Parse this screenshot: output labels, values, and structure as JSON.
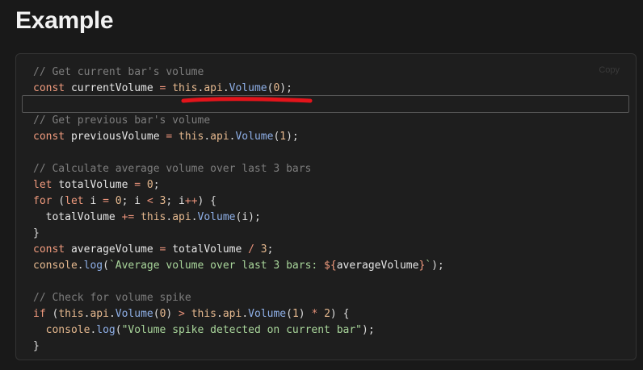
{
  "heading": "Example",
  "copy_label": "Copy",
  "annotation": {
    "underline_color": "#e3141b",
    "box_color": "#565656"
  },
  "code": {
    "lines": [
      [
        {
          "t": "comment",
          "v": "// Get current bar's volume"
        }
      ],
      [
        {
          "t": "keyword",
          "v": "const"
        },
        {
          "t": "punct",
          "v": " "
        },
        {
          "t": "ident",
          "v": "currentVolume"
        },
        {
          "t": "punct",
          "v": " "
        },
        {
          "t": "op",
          "v": "="
        },
        {
          "t": "punct",
          "v": " "
        },
        {
          "t": "property",
          "v": "this"
        },
        {
          "t": "punct",
          "v": "."
        },
        {
          "t": "property",
          "v": "api"
        },
        {
          "t": "punct",
          "v": "."
        },
        {
          "t": "func",
          "v": "Volume"
        },
        {
          "t": "punct",
          "v": "("
        },
        {
          "t": "number",
          "v": "0"
        },
        {
          "t": "punct",
          "v": ");"
        }
      ],
      [],
      [
        {
          "t": "comment",
          "v": "// Get previous bar's volume"
        }
      ],
      [
        {
          "t": "keyword",
          "v": "const"
        },
        {
          "t": "punct",
          "v": " "
        },
        {
          "t": "ident",
          "v": "previousVolume"
        },
        {
          "t": "punct",
          "v": " "
        },
        {
          "t": "op",
          "v": "="
        },
        {
          "t": "punct",
          "v": " "
        },
        {
          "t": "property",
          "v": "this"
        },
        {
          "t": "punct",
          "v": "."
        },
        {
          "t": "property",
          "v": "api"
        },
        {
          "t": "punct",
          "v": "."
        },
        {
          "t": "func",
          "v": "Volume"
        },
        {
          "t": "punct",
          "v": "("
        },
        {
          "t": "number",
          "v": "1"
        },
        {
          "t": "punct",
          "v": ");"
        }
      ],
      [],
      [
        {
          "t": "comment",
          "v": "// Calculate average volume over last 3 bars"
        }
      ],
      [
        {
          "t": "keyword",
          "v": "let"
        },
        {
          "t": "punct",
          "v": " "
        },
        {
          "t": "ident",
          "v": "totalVolume"
        },
        {
          "t": "punct",
          "v": " "
        },
        {
          "t": "op",
          "v": "="
        },
        {
          "t": "punct",
          "v": " "
        },
        {
          "t": "number",
          "v": "0"
        },
        {
          "t": "punct",
          "v": ";"
        }
      ],
      [
        {
          "t": "keyword",
          "v": "for"
        },
        {
          "t": "punct",
          "v": " ("
        },
        {
          "t": "keyword",
          "v": "let"
        },
        {
          "t": "punct",
          "v": " "
        },
        {
          "t": "ident",
          "v": "i"
        },
        {
          "t": "punct",
          "v": " "
        },
        {
          "t": "op",
          "v": "="
        },
        {
          "t": "punct",
          "v": " "
        },
        {
          "t": "number",
          "v": "0"
        },
        {
          "t": "punct",
          "v": "; "
        },
        {
          "t": "ident",
          "v": "i"
        },
        {
          "t": "punct",
          "v": " "
        },
        {
          "t": "op",
          "v": "<"
        },
        {
          "t": "punct",
          "v": " "
        },
        {
          "t": "number",
          "v": "3"
        },
        {
          "t": "punct",
          "v": "; "
        },
        {
          "t": "ident",
          "v": "i"
        },
        {
          "t": "op",
          "v": "++"
        },
        {
          "t": "punct",
          "v": ") {"
        }
      ],
      [
        {
          "t": "punct",
          "v": "  "
        },
        {
          "t": "ident",
          "v": "totalVolume"
        },
        {
          "t": "punct",
          "v": " "
        },
        {
          "t": "op",
          "v": "+="
        },
        {
          "t": "punct",
          "v": " "
        },
        {
          "t": "property",
          "v": "this"
        },
        {
          "t": "punct",
          "v": "."
        },
        {
          "t": "property",
          "v": "api"
        },
        {
          "t": "punct",
          "v": "."
        },
        {
          "t": "func",
          "v": "Volume"
        },
        {
          "t": "punct",
          "v": "("
        },
        {
          "t": "ident",
          "v": "i"
        },
        {
          "t": "punct",
          "v": ");"
        }
      ],
      [
        {
          "t": "punct",
          "v": "}"
        }
      ],
      [
        {
          "t": "keyword",
          "v": "const"
        },
        {
          "t": "punct",
          "v": " "
        },
        {
          "t": "ident",
          "v": "averageVolume"
        },
        {
          "t": "punct",
          "v": " "
        },
        {
          "t": "op",
          "v": "="
        },
        {
          "t": "punct",
          "v": " "
        },
        {
          "t": "ident",
          "v": "totalVolume"
        },
        {
          "t": "punct",
          "v": " "
        },
        {
          "t": "op",
          "v": "/"
        },
        {
          "t": "punct",
          "v": " "
        },
        {
          "t": "number",
          "v": "3"
        },
        {
          "t": "punct",
          "v": ";"
        }
      ],
      [
        {
          "t": "property",
          "v": "console"
        },
        {
          "t": "punct",
          "v": "."
        },
        {
          "t": "func",
          "v": "log"
        },
        {
          "t": "punct",
          "v": "("
        },
        {
          "t": "string",
          "v": "`Average volume over last 3 bars: "
        },
        {
          "t": "interp",
          "v": "${"
        },
        {
          "t": "ident",
          "v": "averageVolume"
        },
        {
          "t": "interp",
          "v": "}"
        },
        {
          "t": "string",
          "v": "`"
        },
        {
          "t": "punct",
          "v": ");"
        }
      ],
      [],
      [
        {
          "t": "comment",
          "v": "// Check for volume spike"
        }
      ],
      [
        {
          "t": "keyword",
          "v": "if"
        },
        {
          "t": "punct",
          "v": " ("
        },
        {
          "t": "property",
          "v": "this"
        },
        {
          "t": "punct",
          "v": "."
        },
        {
          "t": "property",
          "v": "api"
        },
        {
          "t": "punct",
          "v": "."
        },
        {
          "t": "func",
          "v": "Volume"
        },
        {
          "t": "punct",
          "v": "("
        },
        {
          "t": "number",
          "v": "0"
        },
        {
          "t": "punct",
          "v": ") "
        },
        {
          "t": "op",
          "v": ">"
        },
        {
          "t": "punct",
          "v": " "
        },
        {
          "t": "property",
          "v": "this"
        },
        {
          "t": "punct",
          "v": "."
        },
        {
          "t": "property",
          "v": "api"
        },
        {
          "t": "punct",
          "v": "."
        },
        {
          "t": "func",
          "v": "Volume"
        },
        {
          "t": "punct",
          "v": "("
        },
        {
          "t": "number",
          "v": "1"
        },
        {
          "t": "punct",
          "v": ") "
        },
        {
          "t": "op",
          "v": "*"
        },
        {
          "t": "punct",
          "v": " "
        },
        {
          "t": "number",
          "v": "2"
        },
        {
          "t": "punct",
          "v": ") {"
        }
      ],
      [
        {
          "t": "punct",
          "v": "  "
        },
        {
          "t": "property",
          "v": "console"
        },
        {
          "t": "punct",
          "v": "."
        },
        {
          "t": "func",
          "v": "log"
        },
        {
          "t": "punct",
          "v": "("
        },
        {
          "t": "string",
          "v": "\"Volume spike detected on current bar\""
        },
        {
          "t": "punct",
          "v": ");"
        }
      ],
      [
        {
          "t": "punct",
          "v": "}"
        }
      ]
    ]
  }
}
